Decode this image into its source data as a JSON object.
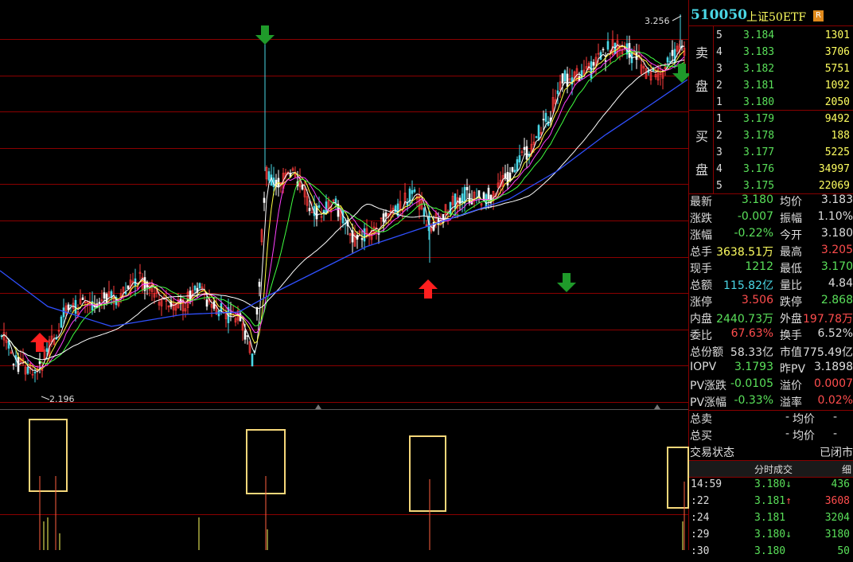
{
  "chart": {
    "price_high_label": "3.256",
    "price_low_label": "2.196",
    "colors": {
      "up": "#ff3b3b",
      "down": "#5ae05a",
      "ma5": "#ffffff",
      "ma10": "#ffff40",
      "ma20": "#ff40ff",
      "ma30": "#40ff40",
      "ma60": "#3050ff",
      "box": "#f5d77a",
      "grid": "#8b0000"
    }
  },
  "header": {
    "code": "510050",
    "name": "上证50ETF",
    "badge": "R"
  },
  "orderbook": {
    "sell_label_1": "卖",
    "sell_label_2": "盘",
    "buy_label_1": "买",
    "buy_label_2": "盘",
    "sell": [
      {
        "level": "5",
        "price": "3.184",
        "vol": "1301"
      },
      {
        "level": "4",
        "price": "3.183",
        "vol": "3706"
      },
      {
        "level": "3",
        "price": "3.182",
        "vol": "5751"
      },
      {
        "level": "2",
        "price": "3.181",
        "vol": "1092"
      },
      {
        "level": "1",
        "price": "3.180",
        "vol": "2050"
      }
    ],
    "buy": [
      {
        "level": "1",
        "price": "3.179",
        "vol": "9492"
      },
      {
        "level": "2",
        "price": "3.178",
        "vol": "188"
      },
      {
        "level": "3",
        "price": "3.177",
        "vol": "5225"
      },
      {
        "level": "4",
        "price": "3.176",
        "vol": "34997"
      },
      {
        "level": "5",
        "price": "3.175",
        "vol": "22069"
      }
    ]
  },
  "info": [
    {
      "k1": "最新",
      "v1": "3.180",
      "c1": "g",
      "k2": "均价",
      "v2": "3.183",
      "c2": "w"
    },
    {
      "k1": "涨跌",
      "v1": "-0.007",
      "c1": "g",
      "k2": "振幅",
      "v2": "1.10%",
      "c2": "w"
    },
    {
      "k1": "涨幅",
      "v1": "-0.22%",
      "c1": "g",
      "k2": "今开",
      "v2": "3.180",
      "c2": "w"
    },
    {
      "k1": "总手",
      "v1": "3638.51万",
      "c1": "y",
      "k2": "最高",
      "v2": "3.205",
      "c2": "r"
    },
    {
      "k1": "现手",
      "v1": "1212",
      "c1": "g",
      "k2": "最低",
      "v2": "3.170",
      "c2": "g"
    },
    {
      "k1": "总额",
      "v1": "115.82亿",
      "c1": "c",
      "k2": "量比",
      "v2": "4.84",
      "c2": "w"
    },
    {
      "k1": "涨停",
      "v1": "3.506",
      "c1": "r",
      "k2": "跌停",
      "v2": "2.868",
      "c2": "g"
    },
    {
      "k1": "内盘",
      "v1": "2440.73万",
      "c1": "g",
      "k2": "外盘",
      "v2": "197.78万",
      "c2": "r"
    },
    {
      "k1": "委比",
      "v1": "67.63%",
      "c1": "r",
      "k2": "换手",
      "v2": "6.52%",
      "c2": "w"
    },
    {
      "k1": "总份额",
      "v1": "58.33亿",
      "c1": "w",
      "k2": "市值",
      "v2": "775.49亿",
      "c2": "w"
    },
    {
      "k1": "IOPV",
      "v1": "3.1793",
      "c1": "g",
      "k2": "昨PV",
      "v2": "3.1898",
      "c2": "w"
    },
    {
      "k1": "PV涨跌",
      "v1": "-0.0105",
      "c1": "g",
      "k2": "溢价",
      "v2": "0.0007",
      "c2": "r"
    },
    {
      "k1": "PV涨幅",
      "v1": "-0.33%",
      "c1": "g",
      "k2": "溢率",
      "v2": "0.02%",
      "c2": "r"
    }
  ],
  "extra": [
    {
      "k1": "总卖",
      "v1": "-",
      "k2": "均价",
      "v2": "-"
    },
    {
      "k1": "总买",
      "v1": "-",
      "k2": "均价",
      "v2": "-"
    }
  ],
  "status": {
    "label": "交易状态",
    "value": "已闭市"
  },
  "trades_header": {
    "title": "分时成交",
    "tab": "细"
  },
  "trades": [
    {
      "time": "14:59",
      "price": "3.180",
      "arrow": "↓",
      "pc": "g",
      "vol": "436",
      "vc": "g"
    },
    {
      "time": ":22",
      "price": "3.181",
      "arrow": "↑",
      "pc": "g",
      "vol": "3608",
      "vc": "r"
    },
    {
      "time": ":24",
      "price": "3.181",
      "arrow": "",
      "pc": "g",
      "vol": "3204",
      "vc": "g"
    },
    {
      "time": ":29",
      "price": "3.180",
      "arrow": "↓",
      "pc": "g",
      "vol": "3180",
      "vc": "g"
    },
    {
      "time": ":30",
      "price": "3.180",
      "arrow": "",
      "pc": "g",
      "vol": "50",
      "vc": "g"
    }
  ]
}
